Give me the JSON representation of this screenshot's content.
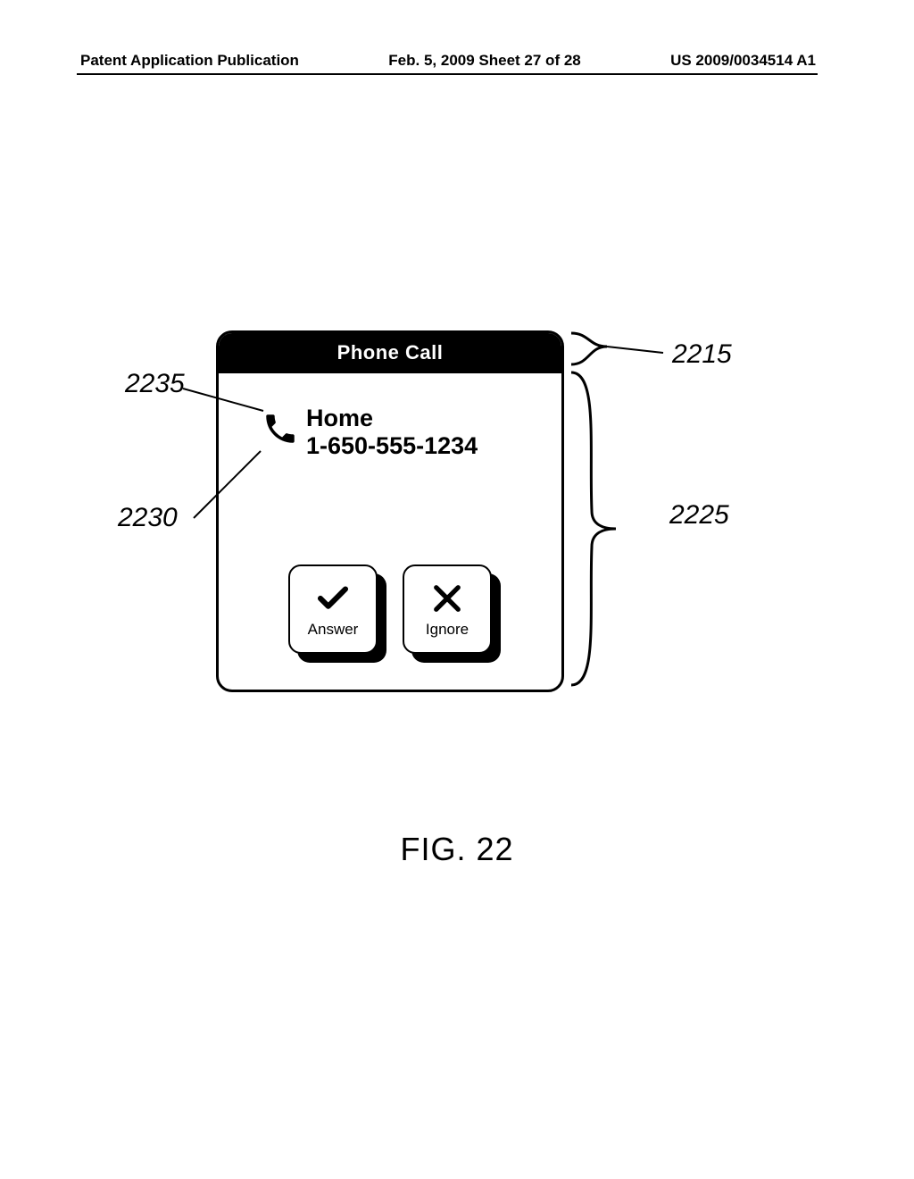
{
  "header": {
    "left": "Patent Application Publication",
    "center": "Feb. 5, 2009  Sheet 27 of 28",
    "right": "US 2009/0034514 A1"
  },
  "dialog": {
    "title": "Phone Call",
    "caller_label": "Home",
    "caller_number": "1-650-555-1234",
    "answer_label": "Answer",
    "ignore_label": "Ignore"
  },
  "refs": {
    "r2215": "2215",
    "r2225": "2225",
    "r2230": "2230",
    "r2235": "2235"
  },
  "figure_label": "FIG. 22"
}
